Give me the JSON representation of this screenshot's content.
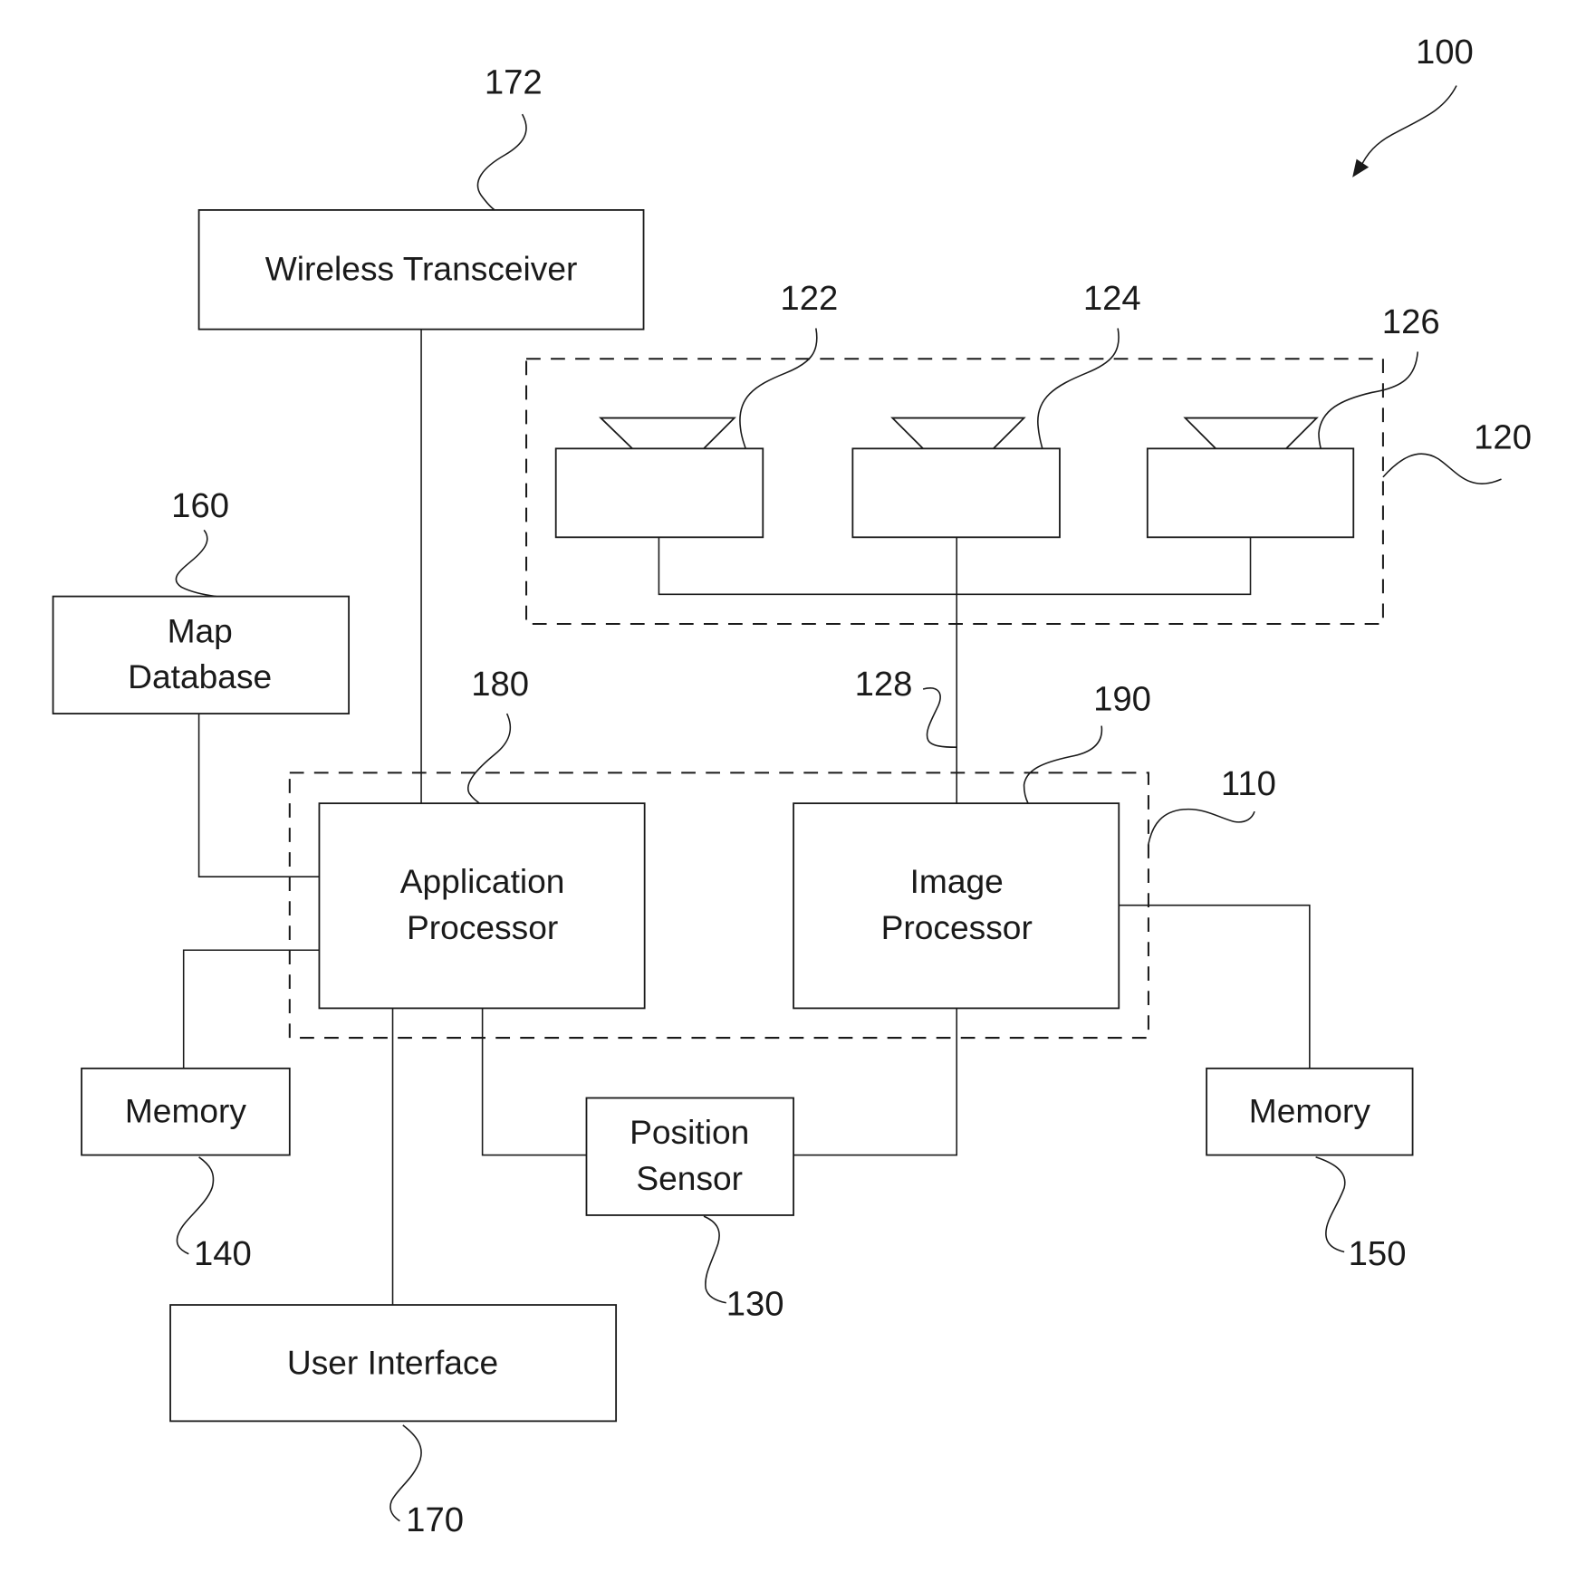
{
  "figure": {
    "reference": "100",
    "colors": {
      "ink": "#1a1a1a",
      "background": "#ffffff"
    }
  },
  "blocks": {
    "wireless_transceiver": {
      "label_lines": [
        "Wireless Transceiver"
      ],
      "ref": "172"
    },
    "map_database": {
      "label_lines": [
        "Map",
        "Database"
      ],
      "ref": "160"
    },
    "application_processor": {
      "label_lines": [
        "Application",
        "Processor"
      ],
      "ref": "180"
    },
    "image_processor": {
      "label_lines": [
        "Image",
        "Processor"
      ],
      "ref": "190"
    },
    "memory_left": {
      "label_lines": [
        "Memory"
      ],
      "ref": "140"
    },
    "memory_right": {
      "label_lines": [
        "Memory"
      ],
      "ref": "150"
    },
    "position_sensor": {
      "label_lines": [
        "Position",
        "Sensor"
      ],
      "ref": "130"
    },
    "user_interface": {
      "label_lines": [
        "User Interface"
      ],
      "ref": "170"
    }
  },
  "groups": {
    "processing_unit": {
      "ref": "110"
    },
    "image_capture_unit": {
      "ref": "120"
    }
  },
  "cameras": [
    {
      "ref": "122"
    },
    {
      "ref": "124"
    },
    {
      "ref": "126"
    }
  ],
  "connections": {
    "data_interface": {
      "ref": "128"
    }
  }
}
